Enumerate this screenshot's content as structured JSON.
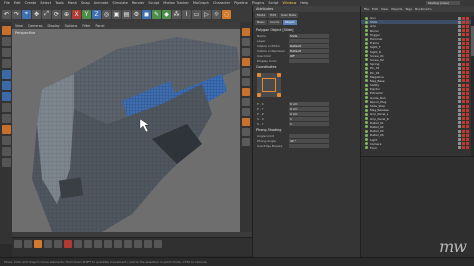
{
  "menubar": {
    "items": [
      "File",
      "Edit",
      "Create",
      "Select",
      "Tools",
      "Mesh",
      "Snap",
      "Animate",
      "Simulate",
      "Render",
      "Sculpt",
      "Motion Tracker",
      "MoGraph",
      "Character",
      "Pipeline",
      "Plugins",
      "Script",
      "Window",
      "Help"
    ],
    "active_index": 17,
    "layout_value": "Startup (User)"
  },
  "viewport": {
    "menu": [
      "View",
      "Cameras",
      "Display",
      "Options",
      "Filter",
      "Panel"
    ],
    "label": "Perspective"
  },
  "attributes": {
    "header": "Attributes",
    "menu": [
      "Mode",
      "Edit",
      "User Data"
    ],
    "tabs": [
      "Basic",
      "Coord.",
      "Object"
    ],
    "section1": "Polygon Object [Slide]",
    "props": [
      {
        "k": "Name",
        "v": "Slide"
      },
      {
        "k": "Layer",
        "v": ""
      },
      {
        "k": "Visible in Editor",
        "v": "Default"
      },
      {
        "k": "Visible in Renderer",
        "v": "Default"
      },
      {
        "k": "Use Color",
        "v": "Off"
      },
      {
        "k": "Display Color",
        "v": ""
      }
    ],
    "section2": "Coordinates",
    "section3": "Phong Shading",
    "props2": [
      {
        "k": "P . X",
        "v": "0 cm"
      },
      {
        "k": "P . Y",
        "v": "0 cm"
      },
      {
        "k": "P . Z",
        "v": "0 cm"
      },
      {
        "k": "S . X",
        "v": "1"
      },
      {
        "k": "S . Y",
        "v": "1"
      }
    ],
    "props3": [
      {
        "k": "Angle Limit",
        "v": ""
      },
      {
        "k": "Phong Angle",
        "v": "40 °"
      },
      {
        "k": "Use Edge Breaks",
        "v": ""
      }
    ]
  },
  "objects": {
    "menu": [
      "File",
      "Edit",
      "View",
      "Objects",
      "Tags",
      "Bookmarks"
    ],
    "rows": [
      "Gun",
      "Slide",
      "Grip",
      "Barrel",
      "Trigger",
      "Hammer",
      "Frame",
      "Sight_F",
      "Sight_R",
      "Screw_01",
      "Screw_02",
      "Spring",
      "Pin_01",
      "Pin_02",
      "Magazine",
      "Mag_Base",
      "Safety",
      "Ejector",
      "Extractor",
      "Guide_Rod",
      "Recoil_Plug",
      "Slide_Stop",
      "Mag_Release",
      "Grip_Panel_L",
      "Grip_Panel_R",
      "Detail_01",
      "Detail_02",
      "Detail_03",
      "Detail_04",
      "Light",
      "Camera",
      "Floor"
    ],
    "selected_index": 1
  },
  "status": {
    "text": "Move: Click and drag to move elements. Hold down SHIFT to quantize movement / add to the selection in point mode, CTRL to remove."
  },
  "watermark": "mw"
}
